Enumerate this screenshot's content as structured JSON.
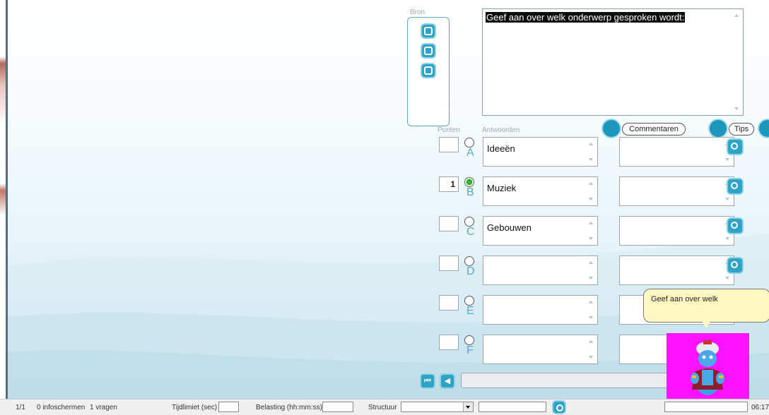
{
  "bron": {
    "label": "Bron",
    "icons": [
      "document-icon",
      "image-icon",
      "frame-icon"
    ]
  },
  "question": {
    "text": "Geef aan over welk onderwerp gesproken wordt:"
  },
  "columns": {
    "punten": "Punten",
    "antwoorden": "Antwoorden"
  },
  "buttons": {
    "commentaren": "Commentaren",
    "tips": "Tips"
  },
  "answers": [
    {
      "letter": "A",
      "points": "",
      "text": "Ideeën",
      "selected": false
    },
    {
      "letter": "B",
      "points": "1",
      "text": "Muziek",
      "selected": true
    },
    {
      "letter": "C",
      "points": "",
      "text": "Gebouwen",
      "selected": false
    },
    {
      "letter": "D",
      "points": "",
      "text": "",
      "selected": false
    },
    {
      "letter": "E",
      "points": "",
      "text": "",
      "selected": false
    },
    {
      "letter": "F",
      "points": "",
      "text": "",
      "selected": false
    }
  ],
  "assistant": {
    "bubble_text": "Geef aan over welk"
  },
  "status": {
    "page": "1/1",
    "infoscreens": "0 infoschermen",
    "questions": "1 vragen",
    "time_limit_label": "Tijdlimiet (sec)",
    "load_label": "Belasting (hh:mm:ss)",
    "structure_label": "Structuur",
    "clock": "06:17"
  },
  "colors": {
    "accent": "#2fa3c5",
    "genie_bg": "#ff12ff",
    "bubble": "#fff8c2"
  }
}
